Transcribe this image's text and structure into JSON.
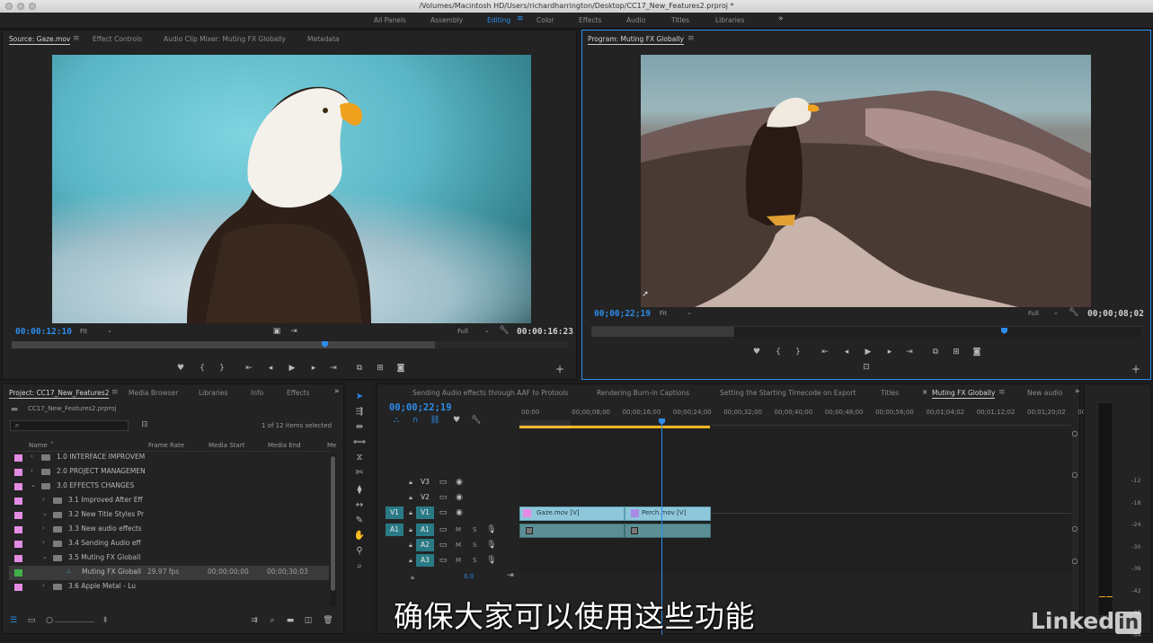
{
  "window": {
    "title": "/Volumes/Macintosh HD/Users/richardharrington/Desktop/CC17_New_Features2.prproj *"
  },
  "workspaces": [
    "All Panels",
    "Assembly",
    "Editing",
    "Color",
    "Effects",
    "Audio",
    "Titles",
    "Libraries"
  ],
  "workspace_more": "»",
  "source": {
    "tabs": [
      "Source: Gaze.mov",
      "Effect Controls",
      "Audio Clip Mixer: Muting FX Globally",
      "Metadata"
    ],
    "timecode": "00:00:12:10",
    "zoom": "Fit",
    "resolution": "Full",
    "duration": "00:00:16:23",
    "playhead_fraction": 0.73
  },
  "program": {
    "tab": "Program: Muting FX Globally",
    "timecode": "00;00;22;19",
    "zoom": "Fit",
    "resolution": "Full",
    "duration": "00;00;08;02",
    "playhead_fraction": 0.74
  },
  "project": {
    "tabs": [
      "Project: CC17_New_Features2",
      "Media Browser",
      "Libraries",
      "Info",
      "Effects"
    ],
    "file": "CC17_New_Features2.prproj",
    "count": "1 of 12 items selected",
    "columns": [
      "Name",
      "Frame Rate",
      "Media Start",
      "Media End",
      "Me"
    ],
    "rows": [
      {
        "label": "1.0 INTERFACE IMPROVEM",
        "indent": 0,
        "open": false,
        "fps": "",
        "start": "",
        "end": "",
        "color": "#e48be3"
      },
      {
        "label": "2.0 PROJECT MANAGEMEN",
        "indent": 0,
        "open": false,
        "fps": "",
        "start": "",
        "end": "",
        "color": "#e48be3"
      },
      {
        "label": "3.0 EFFECTS CHANGES",
        "indent": 0,
        "open": true,
        "fps": "",
        "start": "",
        "end": "",
        "color": "#e48be3"
      },
      {
        "label": "3.1 Improved After Eff",
        "indent": 1,
        "open": false,
        "fps": "",
        "start": "",
        "end": "",
        "color": "#e48be3"
      },
      {
        "label": "3.2 New Title Styles Pr",
        "indent": 1,
        "open": true,
        "fps": "",
        "start": "",
        "end": "",
        "color": "#e48be3"
      },
      {
        "label": "3.3 New audio effects",
        "indent": 1,
        "open": false,
        "fps": "",
        "start": "",
        "end": "",
        "color": "#e48be3"
      },
      {
        "label": "3.4 Sending Audio eff",
        "indent": 1,
        "open": false,
        "fps": "",
        "start": "",
        "end": "",
        "color": "#e48be3"
      },
      {
        "label": "3.5 Muting FX Globall",
        "indent": 1,
        "open": true,
        "fps": "",
        "start": "",
        "end": "",
        "color": "#e48be3"
      },
      {
        "label": "Muting FX Globall",
        "indent": 2,
        "open": null,
        "fps": "29.97 fps",
        "start": "00;00;00;00",
        "end": "00;00;30;03",
        "color": "#3fb04a",
        "selected": true
      },
      {
        "label": "3.6 Apple Metal - Lu",
        "indent": 1,
        "open": false,
        "fps": "",
        "start": "",
        "end": "",
        "color": "#e48be3"
      }
    ]
  },
  "timeline": {
    "tabs": [
      "Sending Audio effects through AAF to Protools",
      "Rendering Burn-in Captions",
      "Setting the Starting Timecode on Export",
      "Titles",
      "Muting FX Globally",
      "New audio"
    ],
    "active_tab": "Muting FX Globally",
    "timecode": "00;00;22;19",
    "ruler": [
      "00:00",
      "00;00;08;00",
      "00;00;16;00",
      "00;00;24;00",
      "00;00;32;00",
      "00;00;40;00",
      "00;00;48;00",
      "00;00;56;00",
      "00;01;04;02",
      "00;01;12;02",
      "00;01;20;02",
      "00;0"
    ],
    "video_tracks": [
      {
        "name": "V3",
        "src": ""
      },
      {
        "name": "V2",
        "src": ""
      },
      {
        "name": "V1",
        "src": "V1"
      }
    ],
    "audio_tracks": [
      {
        "name": "A1",
        "src": "A1"
      },
      {
        "name": "A2",
        "src": ""
      },
      {
        "name": "A3",
        "src": ""
      }
    ],
    "mute_label": "M",
    "solo_label": "S",
    "volume": "0.0",
    "clips": [
      {
        "name": "Gaze.mov [V]"
      },
      {
        "name": "Perch.mov [V]"
      }
    ]
  },
  "meter": {
    "scale": [
      "-12",
      "-18",
      "-24",
      "-30",
      "-36",
      "-42",
      "-48",
      "-54"
    ]
  },
  "subtitle": "确保大家可以使用这些功能",
  "watermark": "Linked"
}
